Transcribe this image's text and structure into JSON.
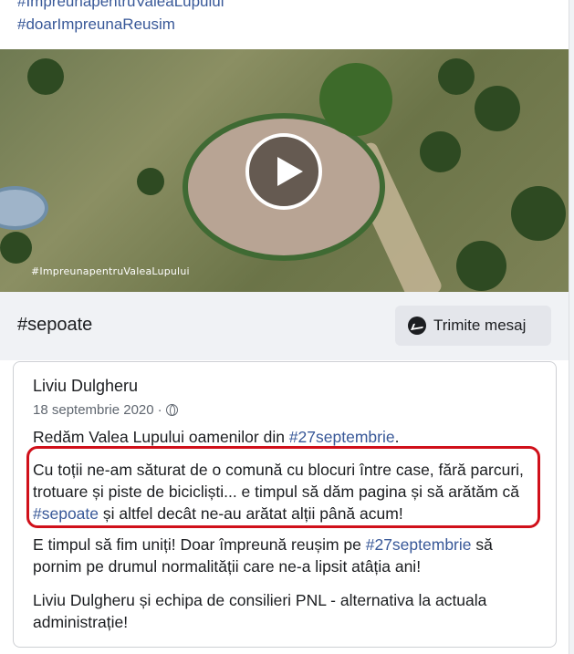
{
  "hashtags_top": [
    "#ImpreunapentruValeaLupului",
    "#doarImpreunaReusim"
  ],
  "video": {
    "watermark": "#ImpreunapentruValeaLupului",
    "play_icon": "play-icon"
  },
  "page_bar": {
    "title": "#sepoate",
    "send_message_label": "Trimite mesaj",
    "icon": "messenger-icon"
  },
  "post": {
    "author": "Liviu Dulgheru",
    "date": "18 septembrie 2020",
    "date_sep": " · ",
    "p1_text": "Redăm Valea Lupului oamenilor din ",
    "p1_hash": "#27septembrie",
    "p1_end": ".",
    "p2_text": "Cu toții ne-am săturat de o comună cu blocuri între case, fără parcuri, trotuare și piste de bicicliști... e timpul să dăm pagina și să arătăm că ",
    "p2_hash": "#sepoate",
    "p2_end": " și altfel decât ne-au arătat alții până acum!",
    "p3_text": "E timpul să fim uniți! Doar împreună reușim pe ",
    "p3_hash": "#27septembrie",
    "p3_end": " să pornim pe drumul normalității care ne-a lipsit atâția ani!",
    "p4_text": "Liviu Dulgheru și echipa de consilieri PNL - alternativa la actuala administrație!"
  },
  "colors": {
    "link": "#385898",
    "highlight": "#d0101a"
  }
}
